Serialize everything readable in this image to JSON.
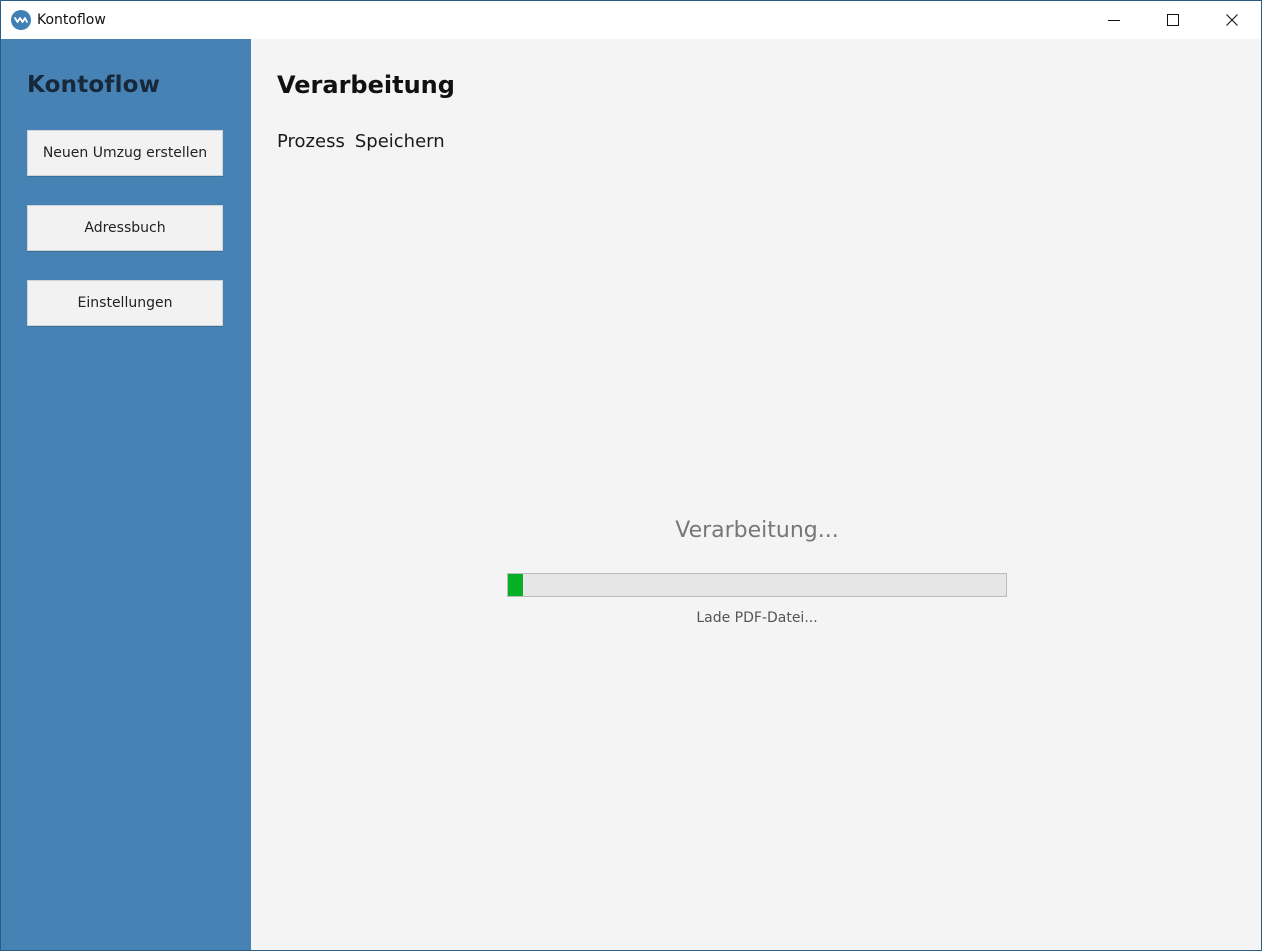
{
  "window": {
    "title": "Kontoflow",
    "icon": "kontoflow-logo-icon",
    "controls": [
      "minimize-icon",
      "maximize-icon",
      "close-icon"
    ]
  },
  "sidebar": {
    "brand": "Kontoflow",
    "background_color": "#4682b4",
    "items": [
      {
        "label": "Neuen Umzug erstellen"
      },
      {
        "label": "Adressbuch"
      },
      {
        "label": "Einstellungen"
      }
    ]
  },
  "main": {
    "title": "Verarbeitung",
    "tabs": [
      {
        "label": "Prozess"
      },
      {
        "label": "Speichern"
      }
    ]
  },
  "progress": {
    "title": "Verarbeitung...",
    "fraction": 0.03,
    "fill_color": "#06b025",
    "detail": "Lade PDF-Datei..."
  }
}
